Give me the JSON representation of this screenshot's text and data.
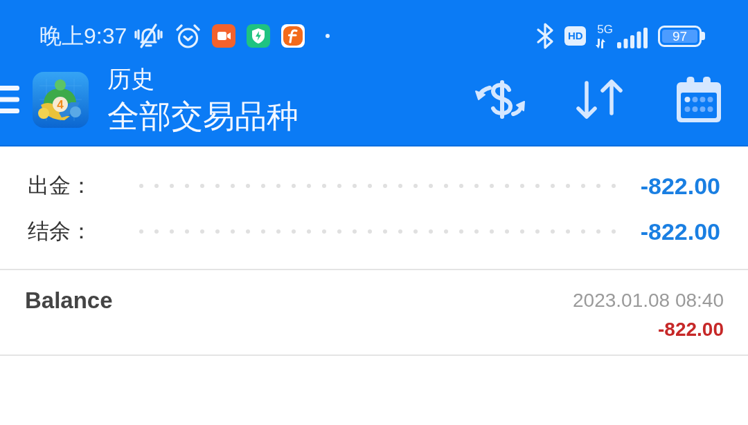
{
  "status_bar": {
    "time": "晚上9:37",
    "hd_badge": "HD",
    "network_type": "5G",
    "battery": "97"
  },
  "header": {
    "app_logo_badge": "4",
    "title": "历史",
    "subtitle": "全部交易品种"
  },
  "summary": [
    {
      "label": "出金：",
      "value": "-822.00"
    },
    {
      "label": "结余：",
      "value": "-822.00"
    }
  ],
  "deals": [
    {
      "name": "Balance",
      "time": "2023.01.08 08:40",
      "profit": "-822.00"
    }
  ]
}
